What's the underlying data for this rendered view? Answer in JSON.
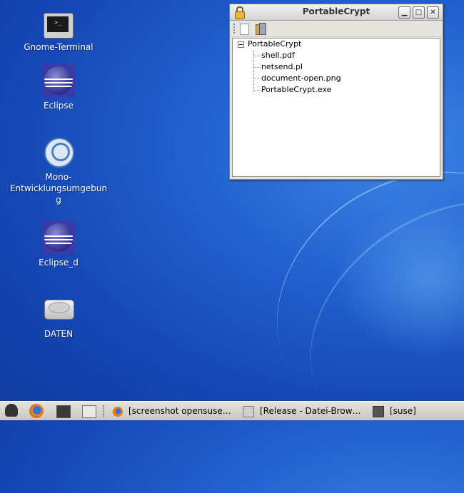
{
  "desktop": {
    "icons": [
      {
        "label": "Gnome-Terminal",
        "icon": "terminal-icon"
      },
      {
        "label": "Eclipse",
        "icon": "eclipse-icon"
      },
      {
        "label": "Mono-\nEntwicklungsumgebun\ng",
        "icon": "mono-icon"
      },
      {
        "label": "Eclipse_d",
        "icon": "eclipse-icon"
      },
      {
        "label": "DATEN",
        "icon": "hard-disk-icon"
      }
    ]
  },
  "window": {
    "title": "PortableCrypt",
    "controls": {
      "minimize": "▁",
      "maximize": "□",
      "close": "✕"
    },
    "toolbar": {
      "new_icon": "new-file-icon",
      "open_icon": "open-file-icon"
    },
    "tree": {
      "root": "PortableCrypt",
      "children": [
        "shell.pdf",
        "netsend.pl",
        "document-open.png",
        "PortableCrypt.exe"
      ]
    }
  },
  "taskbar": {
    "launchers": [
      "gecko-icon",
      "firefox-icon",
      "terminal-icon",
      "home-icon"
    ],
    "tasks": [
      {
        "label": "[screenshot opensuse…",
        "icon": "firefox-icon"
      },
      {
        "label": "[Release - Datei-Brow…",
        "icon": "folder-icon"
      },
      {
        "label": "[suse]",
        "icon": "terminal-icon"
      }
    ]
  },
  "colors": {
    "desktop": "#1b55c4",
    "window_bg": "#e6e4df",
    "taskbar": "#d8d6d1"
  }
}
